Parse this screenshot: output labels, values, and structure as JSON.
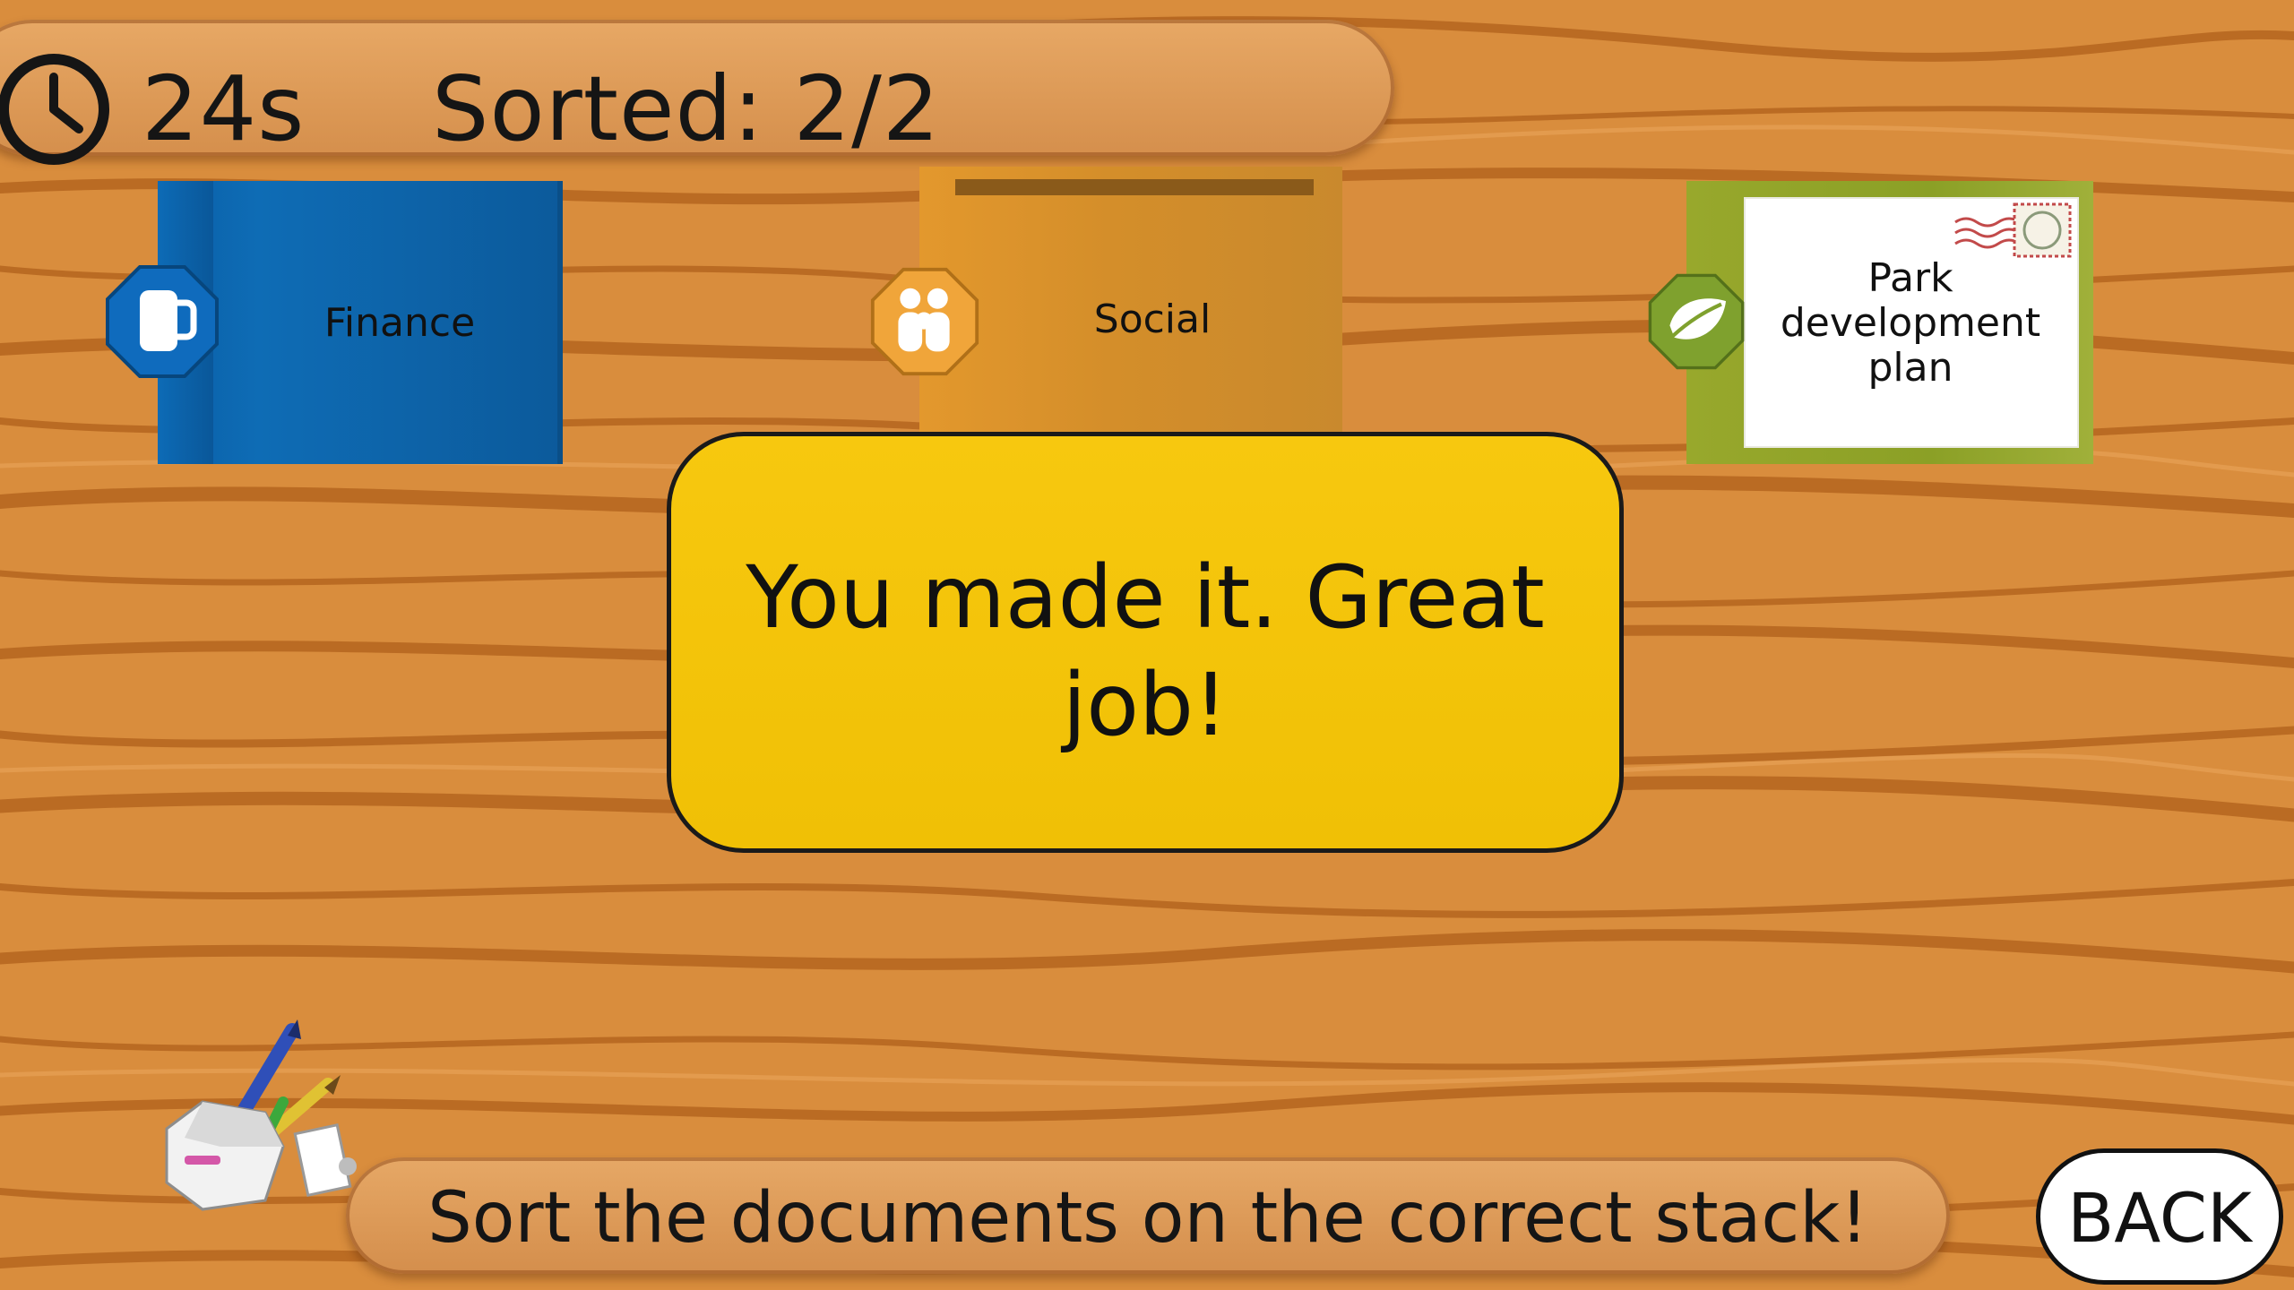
{
  "hud": {
    "timer": "24s",
    "sorted": "Sorted: 2/2"
  },
  "folders": [
    {
      "label": "Finance",
      "color": "#0e6cb5",
      "icon": "mug-icon"
    },
    {
      "label": "Social",
      "color": "#e3982d",
      "icon": "people-icon"
    },
    {
      "label": "Park development plan",
      "color": "#98a82c",
      "icon": "leaf-icon",
      "document": "Park development plan"
    }
  ],
  "dialog": {
    "message": "You made it. Great job!"
  },
  "instruction": "Sort the documents on the correct stack!",
  "back_label": "BACK",
  "colors": {
    "table_wood": "#d98d3d",
    "plank": "#e2a25f",
    "dialog": "#f5c50b"
  }
}
